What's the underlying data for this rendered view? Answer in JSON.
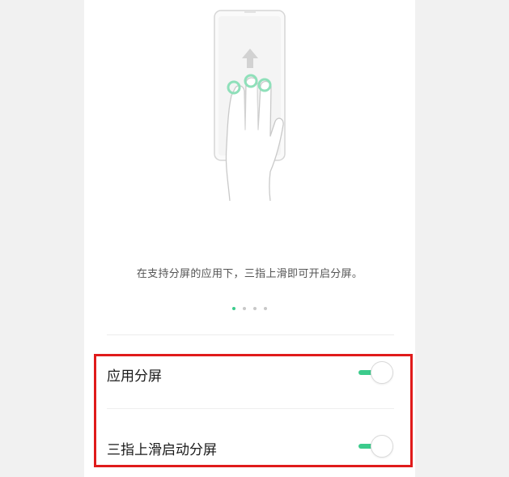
{
  "guide": {
    "caption": "在支持分屏的应用下，三指上滑即可开启分屏。",
    "pages": [
      true,
      false,
      false,
      false
    ]
  },
  "settings": [
    {
      "label": "应用分屏",
      "enabled": true
    },
    {
      "label": "三指上滑启动分屏",
      "enabled": true
    }
  ],
  "colors": {
    "accent": "#3ccb8c",
    "highlight": "#e01b1b"
  }
}
